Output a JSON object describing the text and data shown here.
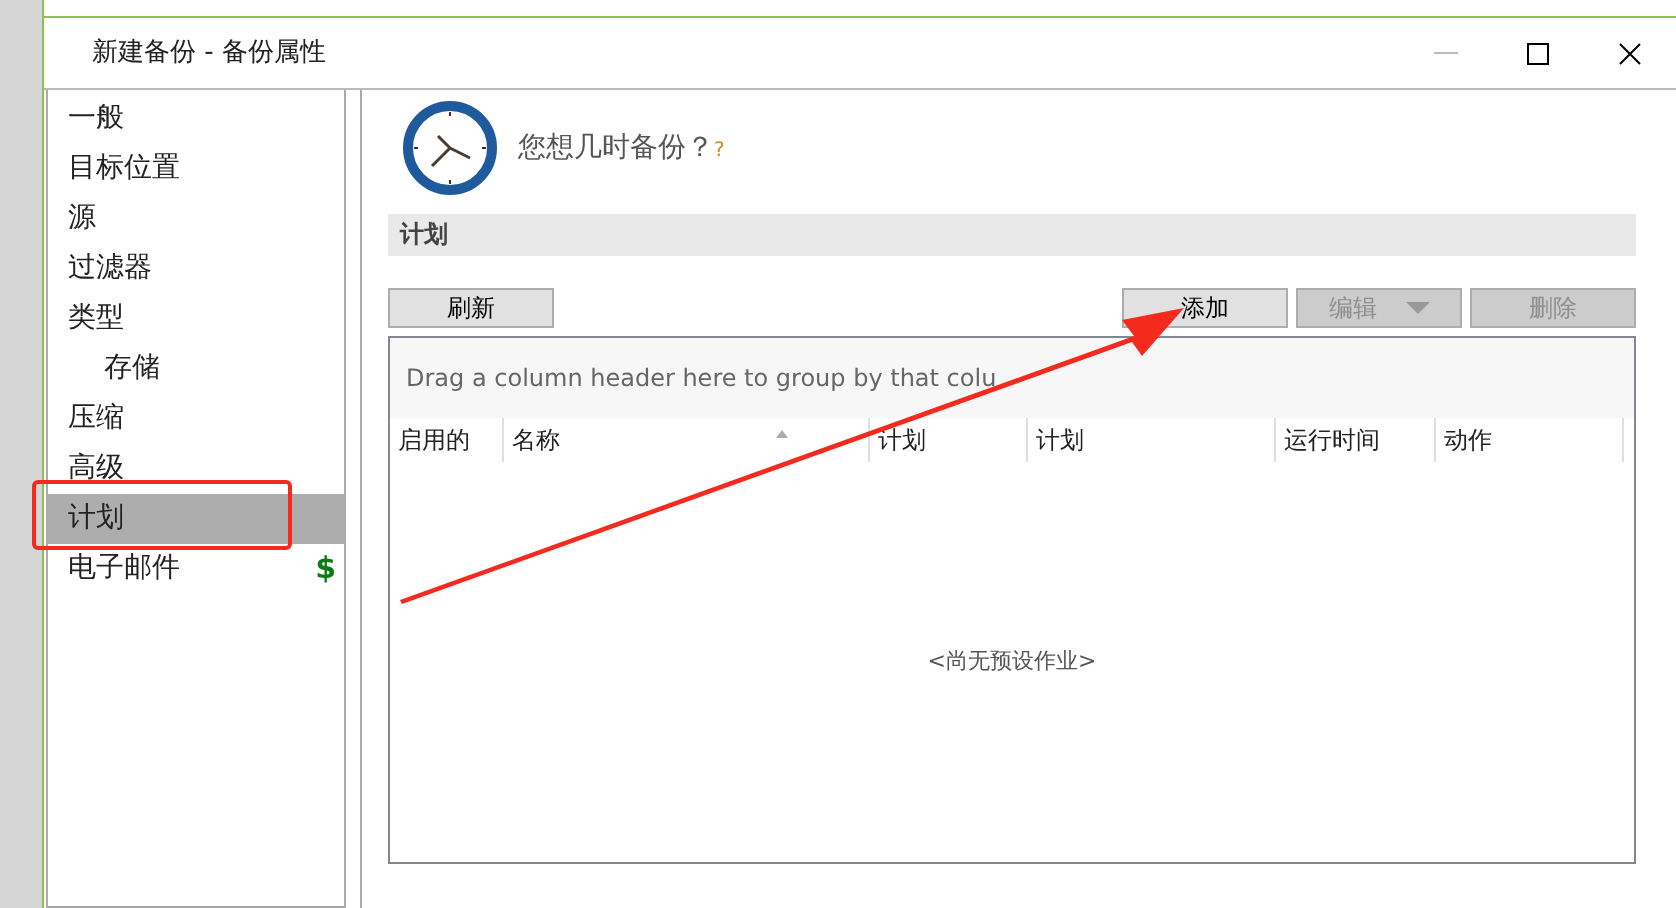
{
  "window": {
    "title": "新建备份 - 备份属性"
  },
  "sidebar": {
    "items": [
      {
        "label": "一般",
        "selected": false
      },
      {
        "label": "目标位置",
        "selected": false
      },
      {
        "label": "源",
        "selected": false
      },
      {
        "label": "过滤器",
        "selected": false
      },
      {
        "label": "类型",
        "selected": false,
        "children": [
          {
            "label": "存储",
            "selected": false
          }
        ]
      },
      {
        "label": "压缩",
        "selected": false
      },
      {
        "label": "高级",
        "selected": false
      },
      {
        "label": "计划",
        "selected": true
      },
      {
        "label": "电子邮件",
        "selected": false,
        "badge": "$"
      }
    ]
  },
  "header": {
    "question": "您想几时备份？",
    "help": "?"
  },
  "section": {
    "title": "计划"
  },
  "toolbar": {
    "left": [
      {
        "label": "刷新",
        "disabled": false
      }
    ],
    "right": [
      {
        "label": "添加",
        "disabled": false,
        "dropdown": false
      },
      {
        "label": "编辑",
        "disabled": true,
        "dropdown": true
      },
      {
        "label": "删除",
        "disabled": true,
        "dropdown": false
      }
    ]
  },
  "grid": {
    "group_panel": "Drag a column header here to group by that colu",
    "columns": [
      {
        "label": "启用的",
        "sorted": false
      },
      {
        "label": "名称",
        "sorted": true
      },
      {
        "label": "计划",
        "sorted": false
      },
      {
        "label": "计划",
        "sorted": false
      },
      {
        "label": "运行时间",
        "sorted": false
      },
      {
        "label": "动作",
        "sorted": false
      }
    ],
    "empty_text": "<尚无预设作业>"
  },
  "annotations": {
    "highlight_box": true,
    "arrow": true
  }
}
